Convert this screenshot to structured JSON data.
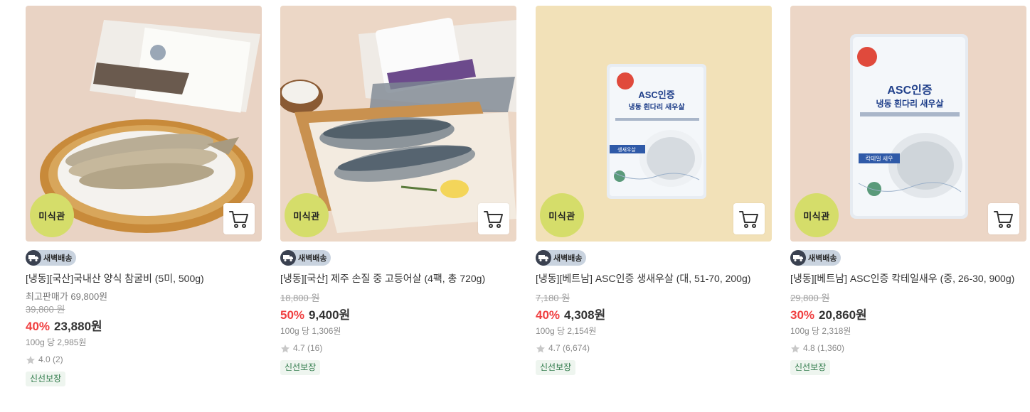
{
  "products": [
    {
      "badge": "미식관",
      "delivery": "새벽배송",
      "name": "[냉동][국산]국내산 양식 참굴비 (5미, 500g)",
      "best_price": "최고판매가 69,800원",
      "original_price": "39,800 원",
      "discount": "40%",
      "price": "23,880원",
      "unit_price": "100g 당 2,985원",
      "rating": "4.0 (2)",
      "tag": "신선보장"
    },
    {
      "badge": "미식관",
      "delivery": "새벽배송",
      "name": "[냉동][국산] 제주 손질 중 고등어살 (4팩, 총 720g)",
      "original_price": "18,800 원",
      "discount": "50%",
      "price": "9,400원",
      "unit_price": "100g 당 1,306원",
      "rating": "4.7 (16)",
      "tag": "신선보장"
    },
    {
      "badge": "미식관",
      "delivery": "새벽배송",
      "name": "[냉동][베트남] ASC인증 생새우살 (대, 51-70, 200g)",
      "original_price": "7,180 원",
      "discount": "40%",
      "price": "4,308원",
      "unit_price": "100g 당 2,154원",
      "rating": "4.7 (6,674)",
      "tag": "신선보장",
      "pack_text": [
        "ASC인증",
        "냉동 흰다리 새우살",
        "생새우살"
      ]
    },
    {
      "badge": "미식관",
      "delivery": "새벽배송",
      "name": "[냉동][베트남] ASC인증 칵테일새우 (중, 26-30, 900g)",
      "original_price": "29,800 원",
      "discount": "30%",
      "price": "20,860원",
      "unit_price": "100g 당 2,318원",
      "rating": "4.8 (1,360)",
      "tag": "신선보장",
      "pack_text": [
        "ASC인증",
        "냉동 흰다리 새우살",
        "칵테일 새우"
      ]
    }
  ],
  "colors": {
    "badge_bg": "#d5dd6a",
    "discount": "#f03f40",
    "tag_text": "#2f7a4a"
  },
  "icons": {
    "cart": "cart-icon",
    "truck": "truck-icon",
    "star": "star-icon"
  }
}
